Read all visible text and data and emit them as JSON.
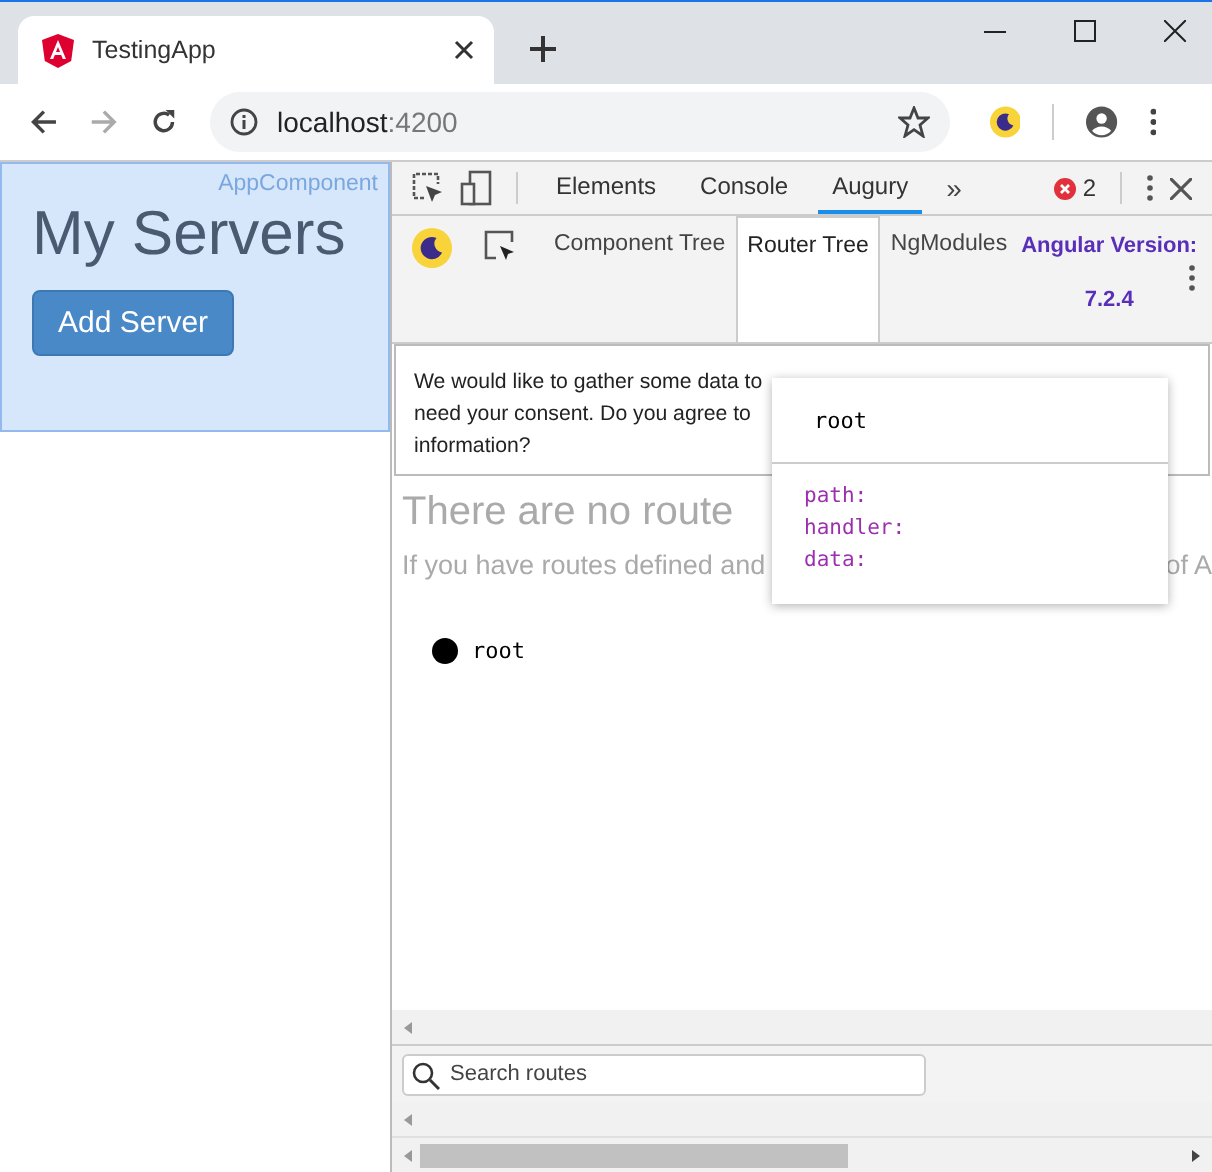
{
  "browser": {
    "tab_title": "TestingApp",
    "url_host": "localhost",
    "url_port": ":4200"
  },
  "page": {
    "component_label": "AppComponent",
    "heading": "My Servers",
    "button": "Add Server"
  },
  "devtools": {
    "tabs": [
      {
        "label": "Elements",
        "selected": false
      },
      {
        "label": "Console",
        "selected": false
      },
      {
        "label": "Augury",
        "selected": true
      }
    ],
    "more": "»",
    "error_count": "2"
  },
  "augury": {
    "tabs": [
      {
        "label": "Component Tree",
        "selected": false
      },
      {
        "label": "Router Tree",
        "selected": true
      },
      {
        "label": "NgModules",
        "selected": false
      }
    ],
    "version_label": "Angular Version:",
    "version": "7.2.4"
  },
  "consent": {
    "lines": [
      "We would like to gather some data to",
      "need your consent. Do you agree to",
      "information?"
    ]
  },
  "empty": {
    "heading": "There are no route",
    "text": "If you have routes defined and",
    "text_tail": "of A"
  },
  "tree": [
    {
      "label": "root"
    }
  ],
  "popover": {
    "title": "root",
    "fields": [
      "path:",
      "handler:",
      "data:"
    ]
  },
  "search": {
    "placeholder": "Search routes"
  }
}
